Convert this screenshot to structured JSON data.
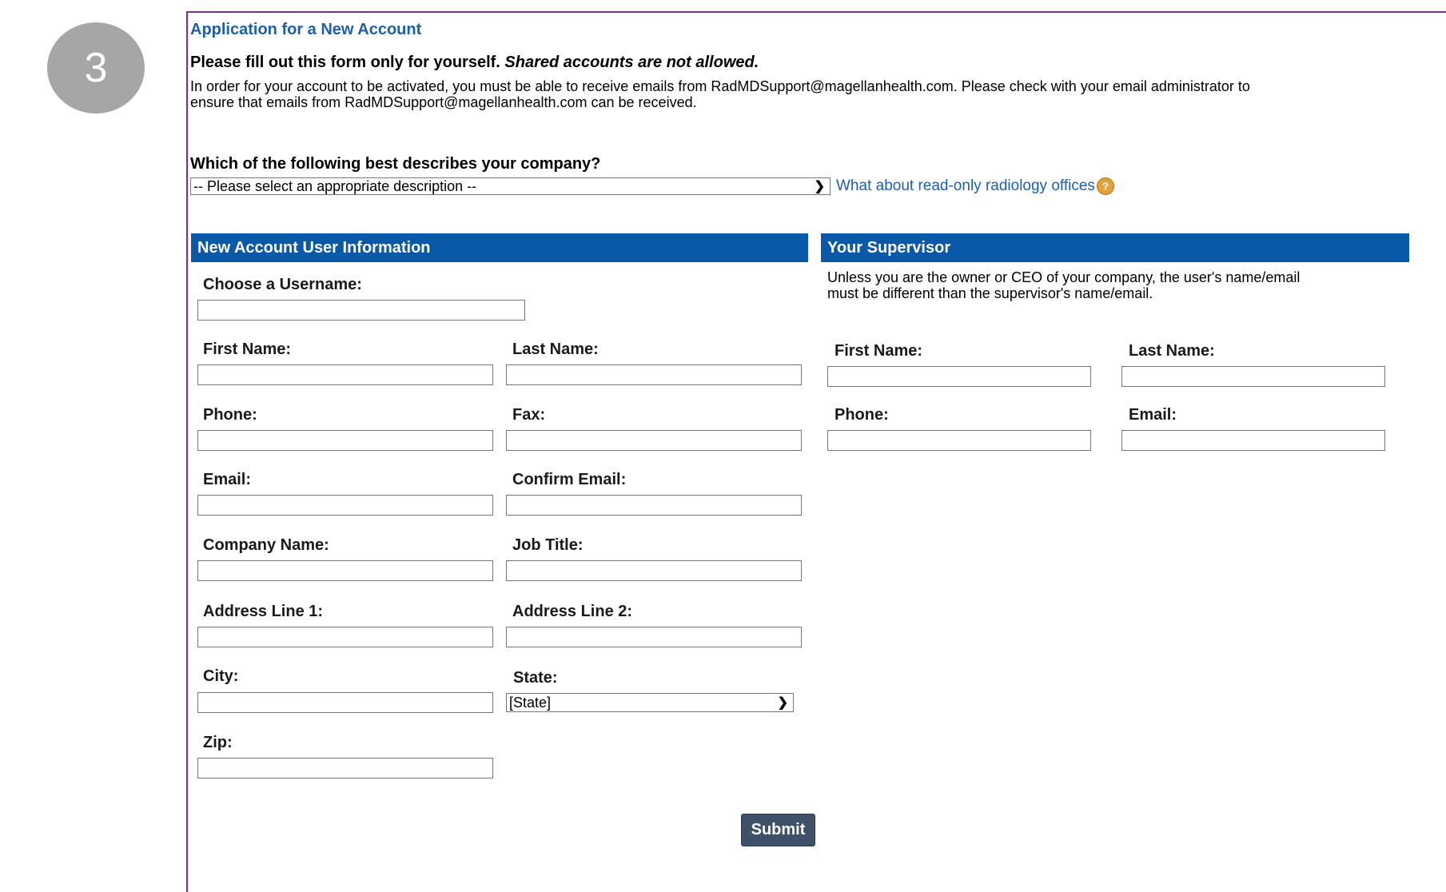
{
  "step_number": "3",
  "form": {
    "title": "Application for a New Account",
    "instruction_bold": "Please fill out this form only for yourself.",
    "instruction_italic": "Shared accounts are not allowed.",
    "note_line1": "In order for your account to be activated, you must be able to receive emails from RadMDSupport@magellanhealth.com. Please check with your email administrator to",
    "note_line2": "ensure that emails from RadMDSupport@magellanhealth.com can be received.",
    "question": "Which of the following best describes your company?",
    "company_select_value": "-- Please select an appropriate description --",
    "readonly_link": "What about read-only radiology offices",
    "submit_label": "Submit"
  },
  "user_info": {
    "header": "New Account User Information",
    "username_label": "Choose a Username:",
    "first_name_label": "First Name:",
    "last_name_label": "Last Name:",
    "phone_label": "Phone:",
    "fax_label": "Fax:",
    "email_label": "Email:",
    "confirm_email_label": "Confirm Email:",
    "company_label": "Company Name:",
    "job_title_label": "Job Title:",
    "address1_label": "Address Line 1:",
    "address2_label": "Address Line 2:",
    "city_label": "City:",
    "state_label": "State:",
    "state_value": "[State]",
    "zip_label": "Zip:"
  },
  "supervisor": {
    "header": "Your Supervisor",
    "note_line1": "Unless you are the owner or CEO of your company, the user's name/email",
    "note_line2": "must be different than the supervisor's name/email.",
    "first_name_label": "First Name:",
    "last_name_label": "Last Name:",
    "phone_label": "Phone:",
    "email_label": "Email:"
  },
  "colors": {
    "header_blue": "#0a58a8",
    "link_blue": "#1f5faa",
    "frame_purple": "#7b2e8e",
    "submit_bg": "#3f5168"
  }
}
